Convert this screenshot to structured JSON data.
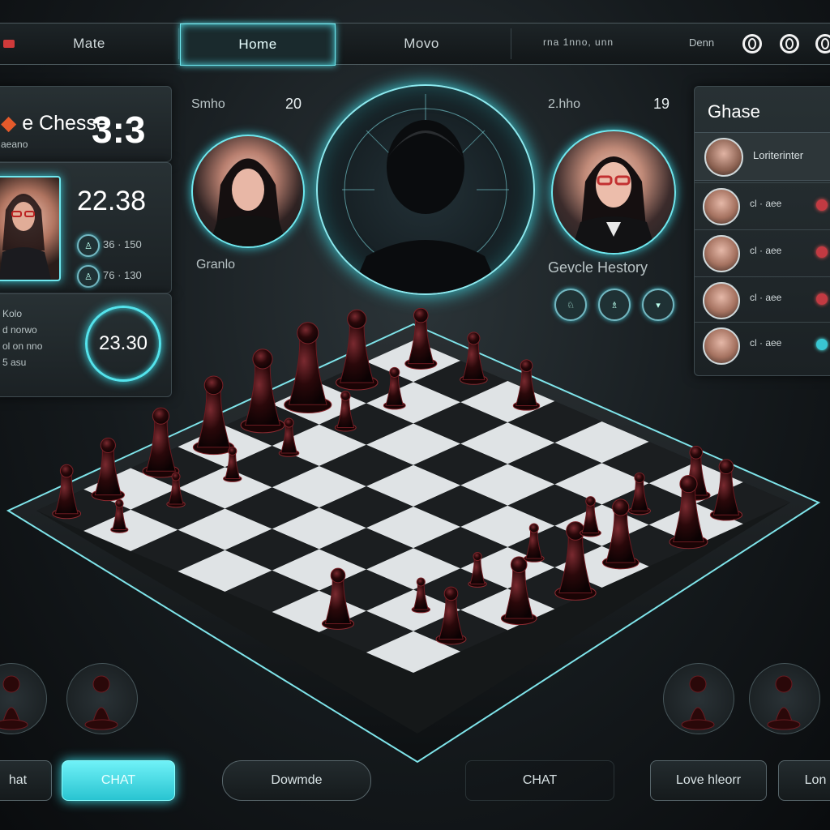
{
  "nav": {
    "tabs": [
      {
        "label": "Mate"
      },
      {
        "label": "Home",
        "active": true
      },
      {
        "label": "Movo"
      }
    ],
    "scribble": "rna 1nno, unn",
    "user_label": "Denn"
  },
  "left_panel": {
    "title": "e Chesse",
    "score": "3:3",
    "subtitle": "aeano",
    "timer": "22.38",
    "stat1": "36 · 150",
    "stat2": "76 · 130",
    "notes": [
      "Kolo",
      "d norwo",
      "ol on nno",
      "5 asu"
    ],
    "clock": "23.30"
  },
  "player_left": {
    "top_label": "Smho",
    "top_number": "20",
    "name": "Granlo"
  },
  "player_right": {
    "top_label": "2.hho",
    "top_number": "19",
    "name": "Gevcle Hestory",
    "btns": [
      "♘",
      "♗",
      "▾"
    ]
  },
  "right_panel": {
    "title": "Ghase",
    "header_text": "Loriterinter",
    "rows": [
      {
        "text": "cl  ·  aee"
      },
      {
        "text": "cl  ·  aee"
      },
      {
        "text": "cl  ·  aee"
      },
      {
        "text": "cl  ·  aee"
      }
    ]
  },
  "bottom": {
    "buttons": [
      "hat",
      "CHAT",
      "Dowmde",
      "CHAT",
      "Love hleorr",
      "Lon"
    ]
  },
  "colors": {
    "accent": "#4fd6df",
    "piece": "#3a0d10",
    "alert": "#c23a42"
  }
}
